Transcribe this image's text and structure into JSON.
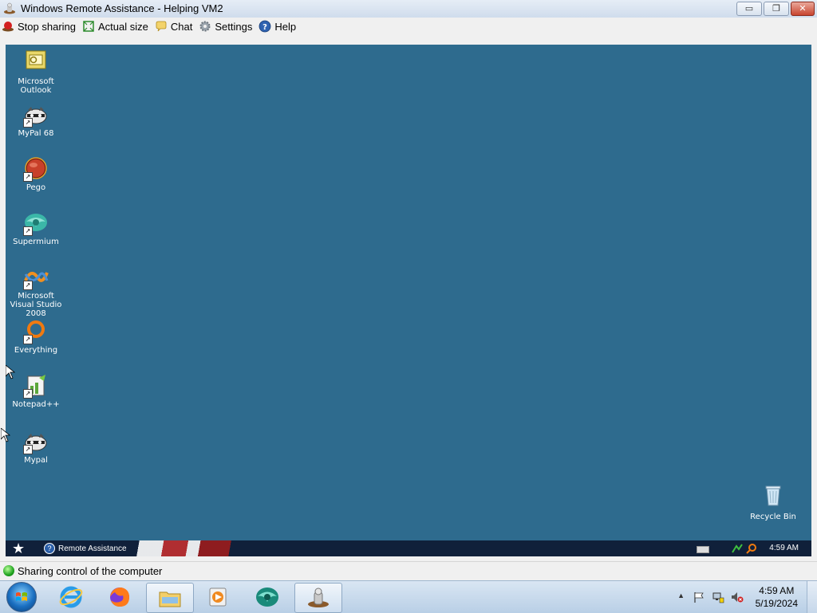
{
  "window": {
    "title": "Windows Remote Assistance - Helping VM2",
    "minimize_glyph": "▭",
    "restore_glyph": "❐",
    "close_glyph": "✕"
  },
  "toolbar": {
    "items": [
      {
        "label": "Stop sharing",
        "icon": "stop-sharing-icon"
      },
      {
        "label": "Actual size",
        "icon": "actual-size-icon"
      },
      {
        "label": "Chat",
        "icon": "chat-icon"
      },
      {
        "label": "Settings",
        "icon": "gear-icon"
      },
      {
        "label": "Help",
        "icon": "help-icon"
      }
    ]
  },
  "remote_desktop": {
    "background_color": "#2e6b8e",
    "icons": [
      {
        "label": "Microsoft Outlook",
        "icon": "outlook-icon"
      },
      {
        "label": "MyPal 68",
        "icon": "mypal-icon"
      },
      {
        "label": "Pego",
        "icon": "pego-icon"
      },
      {
        "label": "Supermium",
        "icon": "supermium-icon"
      },
      {
        "label": "Microsoft Visual Studio 2008",
        "icon": "visual-studio-icon"
      },
      {
        "label": "Everything",
        "icon": "everything-icon"
      },
      {
        "label": "Notepad++",
        "icon": "notepadpp-icon"
      },
      {
        "label": "Mypal",
        "icon": "mypal-icon"
      },
      {
        "label": "Recycle Bin",
        "icon": "recycle-bin-icon"
      }
    ],
    "taskbar": {
      "task_label": "Remote Assistance",
      "time": "4:59 AM"
    }
  },
  "status": {
    "text": "Sharing control of the computer"
  },
  "host_taskbar": {
    "time": "4:59 AM",
    "date": "5/19/2024",
    "tray_arrow": "▲"
  }
}
